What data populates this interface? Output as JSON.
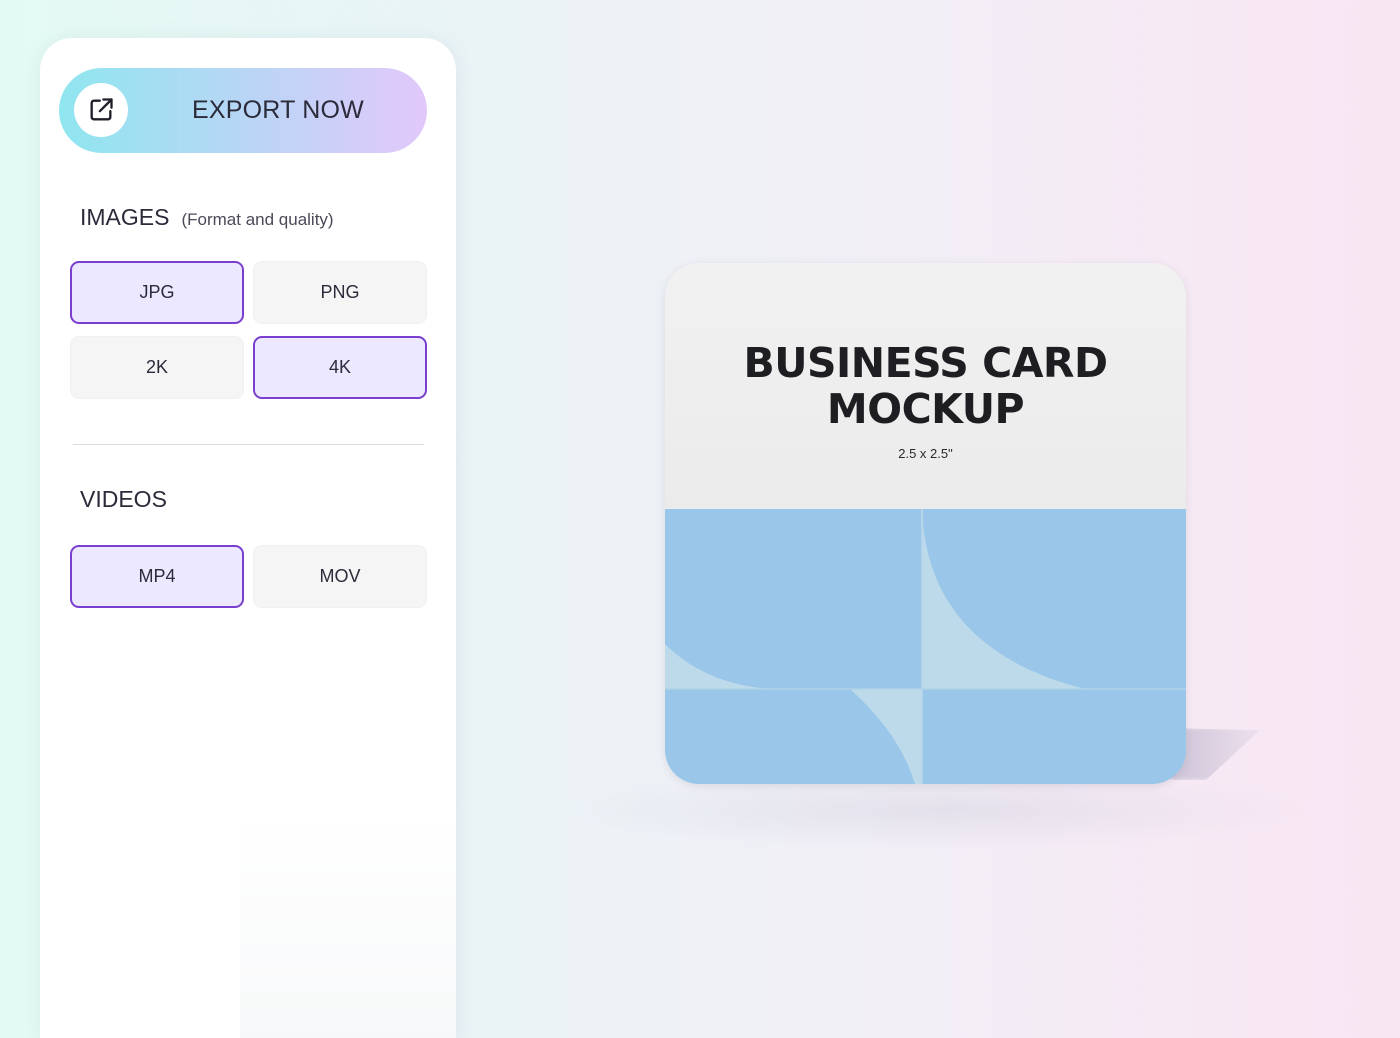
{
  "export": {
    "label": "EXPORT NOW",
    "icon": "external-link-icon"
  },
  "images": {
    "title": "IMAGES",
    "subtitle": "(Format and quality)",
    "options": [
      {
        "label": "JPG",
        "selected": true
      },
      {
        "label": "PNG",
        "selected": false
      },
      {
        "label": "2K",
        "selected": false
      },
      {
        "label": "4K",
        "selected": true
      }
    ]
  },
  "videos": {
    "title": "VIDEOS",
    "options": [
      {
        "label": "MP4",
        "selected": true
      },
      {
        "label": "MOV",
        "selected": false
      }
    ]
  },
  "mockup": {
    "title": "BUSINESS CARD\nMOCKUP",
    "size": "2.5 x 2.5\""
  },
  "colors": {
    "accent": "#7b3fd0",
    "selected_bg": "#ebe8ff",
    "card_blue": "#99c6e9",
    "card_light_blue": "#bcdaea"
  }
}
